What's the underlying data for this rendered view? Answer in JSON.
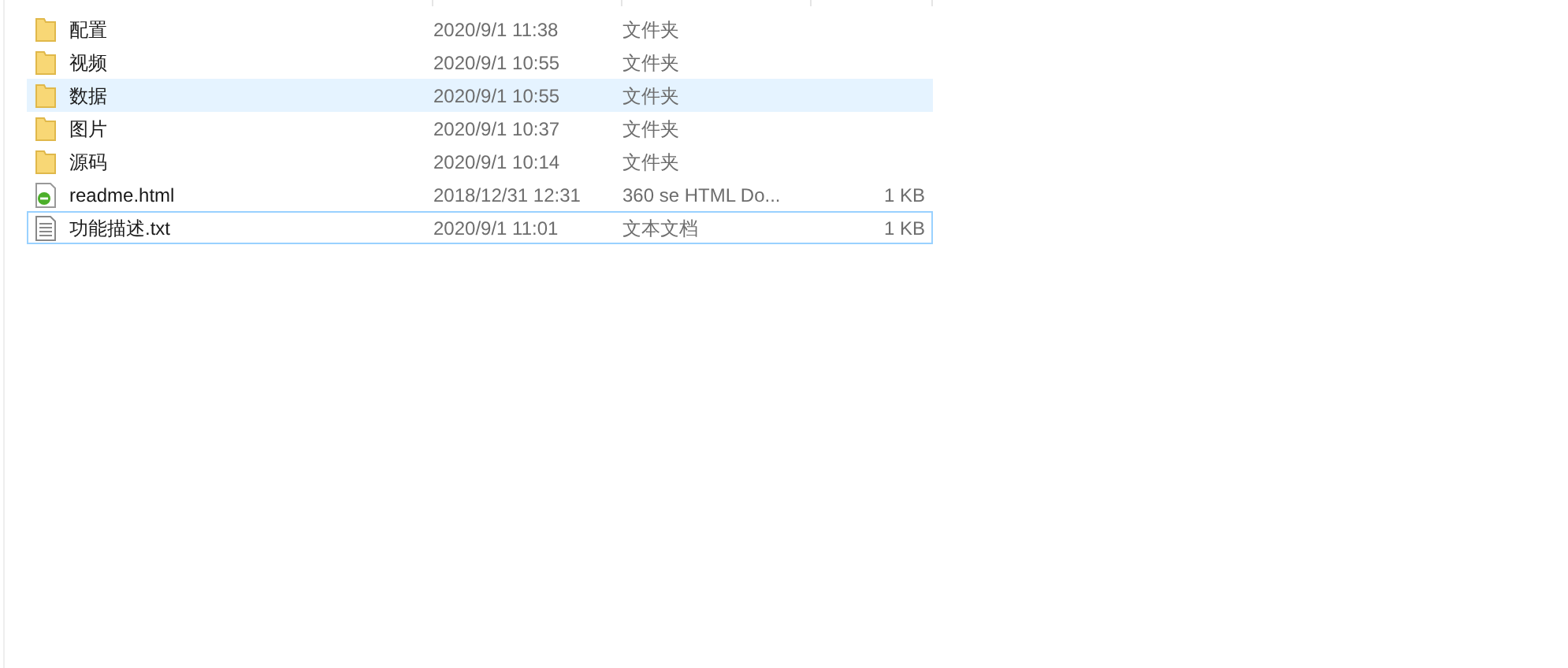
{
  "files": [
    {
      "kind": "folder",
      "name": "配置",
      "date": "2020/9/1 11:38",
      "type": "文件夹",
      "hovered": false,
      "focused": false
    },
    {
      "kind": "folder",
      "name": "视频",
      "date": "2020/9/1 10:55",
      "type": "文件夹",
      "hovered": false,
      "focused": false
    },
    {
      "kind": "folder",
      "name": "数据",
      "date": "2020/9/1 10:55",
      "type": "文件夹",
      "hovered": true,
      "focused": false
    },
    {
      "kind": "folder",
      "name": "图片",
      "date": "2020/9/1 10:37",
      "type": "文件夹",
      "hovered": false,
      "focused": false
    },
    {
      "kind": "folder",
      "name": "源码",
      "date": "2020/9/1 10:14",
      "type": "文件夹",
      "hovered": false,
      "focused": false
    },
    {
      "kind": "html",
      "name": "readme.html",
      "date": "2018/12/31 12:31",
      "type": "360 se HTML Do...",
      "size": "1 KB",
      "hovered": false,
      "focused": false
    },
    {
      "kind": "text",
      "name": "功能描述.txt",
      "date": "2020/9/1 11:01",
      "type": "文本文档",
      "size": "1 KB",
      "hovered": false,
      "focused": true
    }
  ]
}
